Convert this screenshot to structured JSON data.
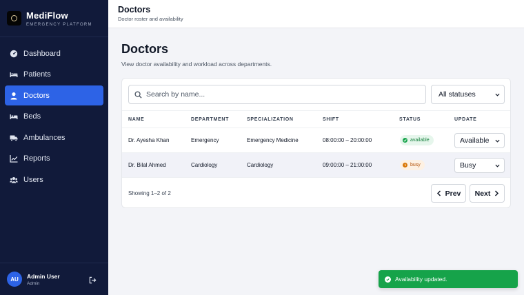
{
  "brand": {
    "name": "MediFlow",
    "tagline": "EMERGENCY PLATFORM"
  },
  "sidebar": {
    "items": [
      {
        "label": "Dashboard",
        "icon": "dashboard-gauge-icon",
        "active": false
      },
      {
        "label": "Patients",
        "icon": "bed-person-icon",
        "active": false
      },
      {
        "label": "Doctors",
        "icon": "user-icon",
        "active": true
      },
      {
        "label": "Beds",
        "icon": "bed-icon",
        "active": false
      },
      {
        "label": "Ambulances",
        "icon": "truck-icon",
        "active": false
      },
      {
        "label": "Reports",
        "icon": "line-chart-icon",
        "active": false
      },
      {
        "label": "Users",
        "icon": "users-icon",
        "active": false
      }
    ]
  },
  "user": {
    "initials": "AU",
    "name": "Admin User",
    "role": "Admin"
  },
  "header": {
    "title": "Doctors",
    "subtitle": "Doctor roster and availability"
  },
  "main": {
    "title": "Doctors",
    "description": "View doctor availability and workload across departments."
  },
  "search": {
    "placeholder": "Search by name...",
    "value": ""
  },
  "status_filter": {
    "selected": "All statuses"
  },
  "table": {
    "columns": [
      "NAME",
      "DEPARTMENT",
      "SPECIALIZATION",
      "SHIFT",
      "STATUS",
      "UPDATE"
    ],
    "rows": [
      {
        "name": "Dr. Ayesha Khan",
        "department": "Emergency",
        "specialization": "Emergency Medicine",
        "shift": "08:00:00 – 20:00:00",
        "status": "available",
        "update": "Available"
      },
      {
        "name": "Dr. Bilal Ahmed",
        "department": "Cardiology",
        "specialization": "Cardiology",
        "shift": "09:00:00 – 21:00:00",
        "status": "busy",
        "update": "Busy"
      }
    ]
  },
  "pagination": {
    "summary": "Showing 1–2 of 2",
    "prev_label": "Prev",
    "next_label": "Next"
  },
  "toast": {
    "message": "Availability updated.",
    "icon": "check-circle-icon"
  },
  "colors": {
    "sidebar_bg": "#111a3a",
    "accent": "#2d63e6",
    "success": "#16a34a",
    "warning": "#d97706"
  }
}
